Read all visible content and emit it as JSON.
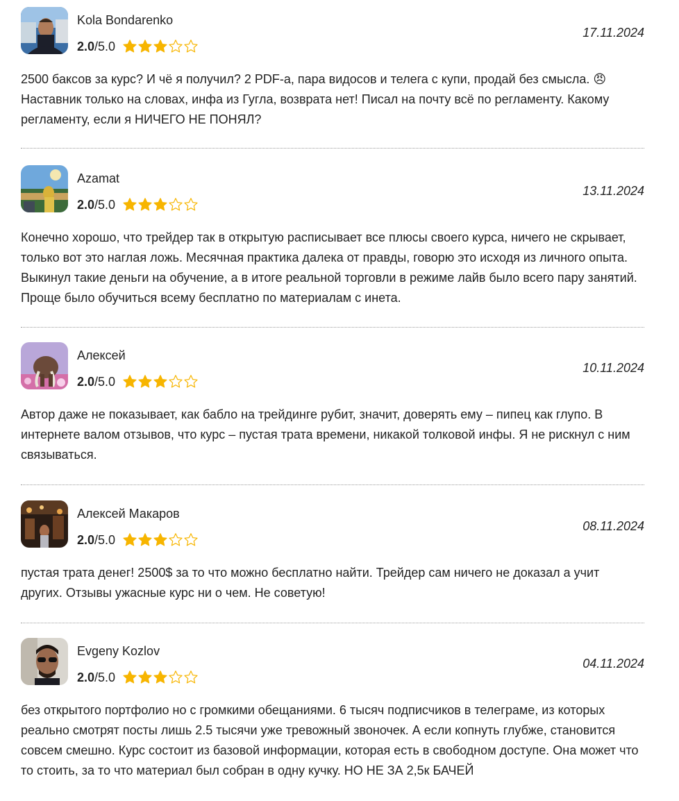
{
  "reviews": [
    {
      "name": "Kola Bondarenko",
      "score": "2.0",
      "score_max": "/5.0",
      "stars": 3,
      "star_color": "#f7b500",
      "date": "17.11.2024",
      "text": "2500 баксов за курс? И чё я получил? 2 PDF-а, пара видосов и телега с купи, продай без смысла. 😠 Наставник только на словах, инфа из Гугла, возврата нет! Писал на почту всё по регламенту. Какому регламенту, если я НИЧЕГО НЕ ПОНЯЛ?"
    },
    {
      "name": "Azamat",
      "score": "2.0",
      "score_max": "/5.0",
      "stars": 3,
      "star_color": "#f7b500",
      "date": "13.11.2024",
      "text": "Конечно хорошо, что трейдер так в открытую расписывает все плюсы своего курса, ничего не скрывает, только вот это наглая ложь. Месячная практика далека от правды, говорю это исходя из личного опыта. Выкинул такие деньги на обучение, а в итоге реальной торговли в режиме лайв было всего пару занятий. Проще было обучиться всему бесплатно по материалам с инета."
    },
    {
      "name": "Алексей",
      "score": "2.0",
      "score_max": "/5.0",
      "stars": 3,
      "star_color": "#f7b500",
      "date": "10.11.2024",
      "text": "Автор даже не показывает, как бабло на трейдинге рубит, значит, доверять ему – пипец как глупо. В интернете валом отзывов, что курс – пустая трата времени, никакой толковой инфы. Я не рискнул с ним связываться."
    },
    {
      "name": "Алексей Макаров",
      "score": "2.0",
      "score_max": "/5.0",
      "stars": 3,
      "star_color": "#f7b500",
      "date": "08.11.2024",
      "text": "пустая трата денег! 2500$ за то что можно бесплатно найти. Трейдер сам ничего не доказал а учит других. Отзывы ужасные курс ни о чем. Не советую!"
    },
    {
      "name": "Evgeny Kozlov",
      "score": "2.0",
      "score_max": "/5.0",
      "stars": 3,
      "star_color": "#f7b500",
      "date": "04.11.2024",
      "text": "без открытого портфолио но с громкими обещаниями. 6 тысяч подписчиков в телеграме, из которых реально смотрят посты лишь 2.5 тысячи уже тревожный звоночек. А если копнуть глубже, становится совсем смешно. Курс состоит из базовой информации, которая есть в свободном доступе. Она может что то стоить, за то что материал был собран в одну кучку. НО НЕ ЗА 2,5к БАЧЕЙ"
    }
  ]
}
